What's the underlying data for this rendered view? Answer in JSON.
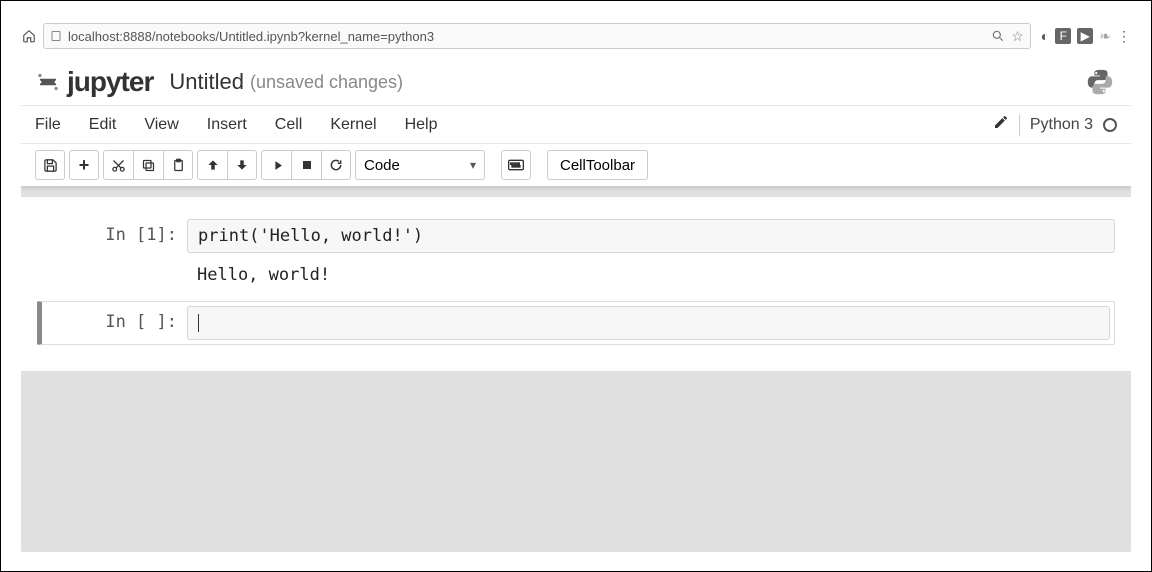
{
  "browser": {
    "url": "localhost:8888/notebooks/Untitled.ipynb?kernel_name=python3"
  },
  "header": {
    "logo_text": "jupyter",
    "title": "Untitled",
    "status": "(unsaved changes)"
  },
  "menubar": {
    "items": [
      "File",
      "Edit",
      "View",
      "Insert",
      "Cell",
      "Kernel",
      "Help"
    ],
    "kernel_label": "Python 3"
  },
  "toolbar": {
    "celltype_selected": "Code",
    "celltoolbar_label": "CellToolbar"
  },
  "cells": [
    {
      "prompt": "In [1]:",
      "source": "print('Hello, world!')",
      "output": "Hello, world!"
    },
    {
      "prompt": "In [ ]:",
      "source": ""
    }
  ]
}
